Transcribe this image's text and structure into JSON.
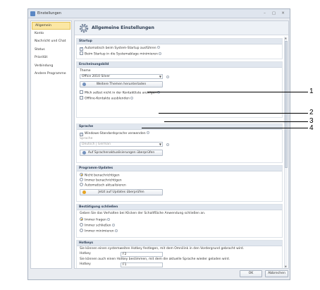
{
  "window": {
    "title": "Einstellungen",
    "controls": [
      "–",
      "▢",
      "✕"
    ]
  },
  "sidebar": {
    "items": [
      {
        "label": "Allgemein",
        "active": true
      },
      {
        "label": "Konto"
      },
      {
        "label": "Nachricht und Chat"
      },
      {
        "label": "Status"
      },
      {
        "label": "Priorität"
      },
      {
        "label": "Verbindung"
      },
      {
        "label": "Andere Programme"
      }
    ]
  },
  "header": {
    "title": "Allgemeine Einstellungen"
  },
  "startup": {
    "title": "Startup",
    "auto": "Automatisch beim System-Startup ausführen",
    "tray": "Beim Startup in die Systemablage minimieren"
  },
  "appearance": {
    "title": "Erscheinungsbild",
    "theme_label": "Theme",
    "theme_value": "Office 2010 Silver",
    "download_button": "Weitere Themen herunterladen",
    "hide_self": "Mich selbst nicht in der Kontaktliste anzeigen",
    "hide_offline": "Offline-Kontakte ausblenden"
  },
  "language": {
    "title": "Sprache",
    "use_windows": "Windows-Standardsprache verwenden",
    "lang_label": "Sprache",
    "lang_value": "Deutsch | German",
    "update_button": "Auf Sprachenaktualisierungen überprüfen"
  },
  "updates": {
    "title": "Programm-Updates",
    "options": [
      "Nicht benachrichtigen",
      "Immer benachrichtigen",
      "Automatisch aktualisieren"
    ],
    "check_button": "Jetzt auf Updates überprüfen"
  },
  "confirm": {
    "title": "Bestätigung schließen",
    "desc": "Geben Sie das Verhalten bei Klicken der Schaltfläche Anwendung schließen an.",
    "options": [
      "Immer fragen",
      "Immer schließen",
      "Immer minimieren"
    ]
  },
  "hotkeys": {
    "title": "Hotkeys",
    "desc1": "Sie können einen systemweiten Hotkey festlegen, mit dem Omnilink in den Vordergrund gebracht wird.",
    "label1": "Hotkey",
    "value1": "F2",
    "desc2": "Sie können auch einen Hotkey bestimmen, mit dem die aktuelle Sprache wieder geladen wird.",
    "label2": "Hotkey",
    "value2": "F1"
  },
  "footer": {
    "ok": "OK",
    "cancel": "Abbrechen"
  },
  "callouts": [
    "1",
    "2",
    "3",
    "4"
  ]
}
